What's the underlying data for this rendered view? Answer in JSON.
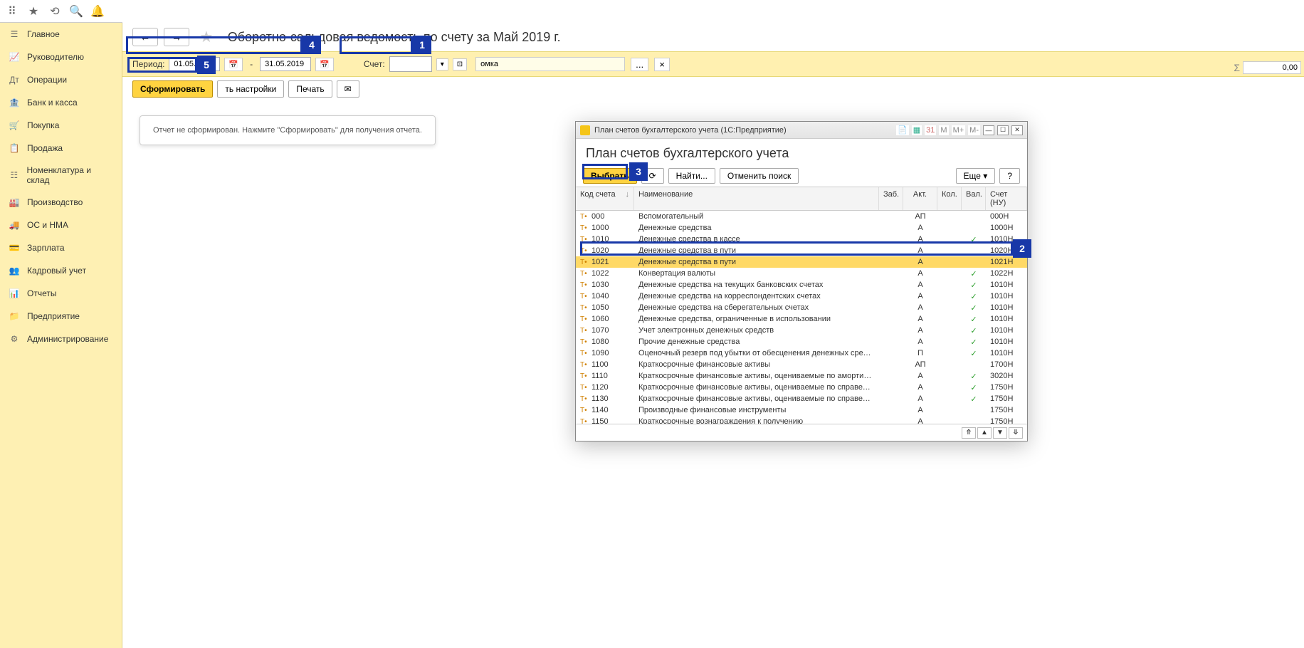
{
  "topbar": {
    "icons": [
      "apps",
      "star",
      "history",
      "search",
      "bell"
    ]
  },
  "sidebar": {
    "items": [
      {
        "icon": "☰",
        "label": "Главное"
      },
      {
        "icon": "📈",
        "label": "Руководителю"
      },
      {
        "icon": "Дт",
        "label": "Операции"
      },
      {
        "icon": "🏦",
        "label": "Банк и касса"
      },
      {
        "icon": "🛒",
        "label": "Покупка"
      },
      {
        "icon": "📋",
        "label": "Продажа"
      },
      {
        "icon": "☷",
        "label": "Номенклатура и склад"
      },
      {
        "icon": "🏭",
        "label": "Производство"
      },
      {
        "icon": "🚚",
        "label": "ОС и НМА"
      },
      {
        "icon": "💳",
        "label": "Зарплата"
      },
      {
        "icon": "👥",
        "label": "Кадровый учет"
      },
      {
        "icon": "📊",
        "label": "Отчеты"
      },
      {
        "icon": "📁",
        "label": "Предприятие"
      },
      {
        "icon": "⚙",
        "label": "Администрирование"
      }
    ]
  },
  "header": {
    "back": "←",
    "forward": "→",
    "title": "Оборотно-сальдовая ведомость по счету   за Май 2019 г."
  },
  "period": {
    "label": "Период:",
    "from": "01.05.2019",
    "to": "31.05.2019",
    "dash": "-",
    "account_label": "Счет:",
    "account": "",
    "org_value": "омка",
    "ellipsis": "...",
    "clear": "×"
  },
  "actions": {
    "generate": "Сформировать",
    "settings": "ть настройки",
    "print": "Печать"
  },
  "message": "Отчет не сформирован. Нажмите \"Сформировать\" для получения отчета.",
  "sigma": {
    "label": "Σ",
    "value": "0,00"
  },
  "callouts": {
    "c1": "1",
    "c2": "2",
    "c3": "3",
    "c4": "4",
    "c5": "5"
  },
  "modal": {
    "titlebar": "План счетов бухгалтерского учета  (1С:Предприятие)",
    "m_buttons": [
      "M",
      "M+",
      "M-"
    ],
    "heading": "План счетов бухгалтерского учета",
    "btn_select": "Выбрать",
    "btn_find": "Найти...",
    "btn_cancel": "Отменить поиск",
    "btn_more": "Еще",
    "btn_help": "?",
    "cols": {
      "code": "Код счета",
      "name": "Наименование",
      "zab": "Заб.",
      "akt": "Акт.",
      "kol": "Кол.",
      "val": "Вал.",
      "nu": "Счет (НУ)"
    },
    "rows": [
      {
        "code": "000",
        "name": "Вспомогательный",
        "akt": "АП",
        "val": "",
        "nu": "000Н"
      },
      {
        "code": "1000",
        "name": "Денежные средства",
        "akt": "А",
        "val": "",
        "nu": "1000Н"
      },
      {
        "code": "1010",
        "name": "Денежные средства в кассе",
        "akt": "А",
        "val": "✓",
        "nu": "1010Н"
      },
      {
        "code": "1020",
        "name": "Денежные средства в пути",
        "akt": "А",
        "val": "",
        "nu": "1020Н"
      },
      {
        "code": "1021",
        "name": "Денежные средства в пути",
        "akt": "А",
        "val": "",
        "nu": "1021Н",
        "selected": true
      },
      {
        "code": "1022",
        "name": "Конвертация валюты",
        "akt": "А",
        "val": "✓",
        "nu": "1022Н"
      },
      {
        "code": "1030",
        "name": "Денежные средства на текущих банковских счетах",
        "akt": "А",
        "val": "✓",
        "nu": "1010Н"
      },
      {
        "code": "1040",
        "name": "Денежные средства на корреспондентских счетах",
        "akt": "А",
        "val": "✓",
        "nu": "1010Н"
      },
      {
        "code": "1050",
        "name": "Денежные средства на сберегательных счетах",
        "akt": "А",
        "val": "✓",
        "nu": "1010Н"
      },
      {
        "code": "1060",
        "name": "Денежные средства, ограниченные в использовании",
        "akt": "А",
        "val": "✓",
        "nu": "1010Н"
      },
      {
        "code": "1070",
        "name": "Учет электронных денежных средств",
        "akt": "А",
        "val": "✓",
        "nu": "1010Н"
      },
      {
        "code": "1080",
        "name": "Прочие денежные средства",
        "akt": "А",
        "val": "✓",
        "nu": "1010Н"
      },
      {
        "code": "1090",
        "name": "Оценочный резерв под убытки от обесценения денежных средств",
        "akt": "П",
        "val": "✓",
        "nu": "1010Н"
      },
      {
        "code": "1100",
        "name": "Краткосрочные финансовые активы",
        "akt": "АП",
        "val": "",
        "nu": "1700Н"
      },
      {
        "code": "1110",
        "name": "Краткосрочные финансовые активы, оцениваемые по амортизирова…",
        "akt": "А",
        "val": "✓",
        "nu": "3020Н"
      },
      {
        "code": "1120",
        "name": "Краткосрочные финансовые активы, оцениваемые по справедливой…",
        "akt": "А",
        "val": "✓",
        "nu": "1750Н"
      },
      {
        "code": "1130",
        "name": "Краткосрочные финансовые активы, оцениваемые по справедливой…",
        "akt": "А",
        "val": "✓",
        "nu": "1750Н"
      },
      {
        "code": "1140",
        "name": "Производные финансовые инструменты",
        "akt": "А",
        "val": "",
        "nu": "1750Н"
      },
      {
        "code": "1150",
        "name": "Краткосрочные вознаграждения к получению",
        "akt": "А",
        "val": "",
        "nu": "1750Н"
      }
    ]
  }
}
